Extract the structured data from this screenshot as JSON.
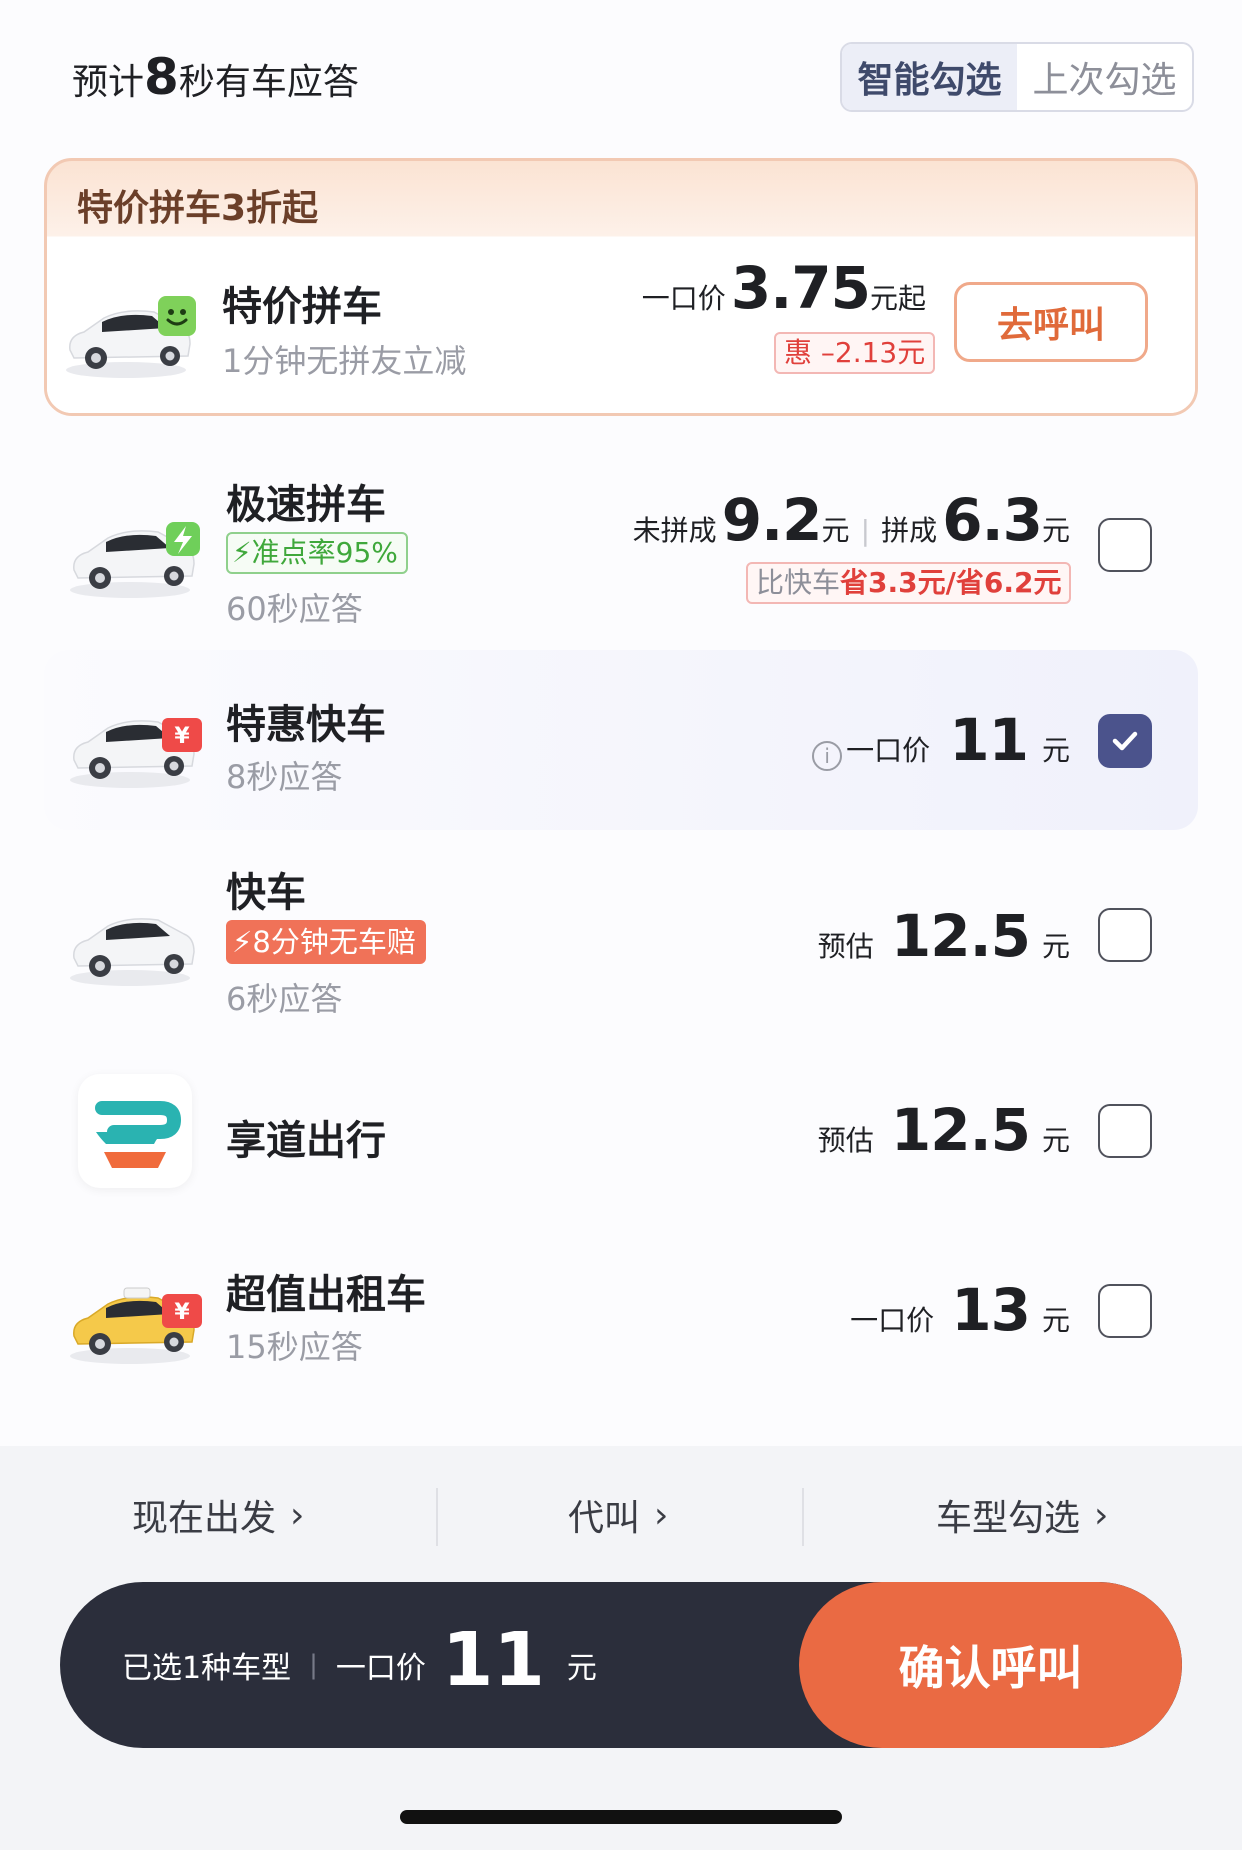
{
  "header": {
    "eta_prefix": "预计",
    "eta_seconds": "8",
    "eta_suffix": "秒有车应答",
    "segment": {
      "options": [
        "智能勾选",
        "上次勾选"
      ],
      "active_index": 0
    }
  },
  "promo": {
    "title": "特价拼车3折起",
    "ride": {
      "name": "特价拼车",
      "subtitle": "1分钟无拼友立减",
      "price_label": "一口价",
      "price": "3.75",
      "price_unit": "元起",
      "discount": "惠 –2.13元",
      "call_label": "去呼叫"
    }
  },
  "rides": [
    {
      "name": "极速拼车",
      "tag": "准点率95%",
      "subtitle": "60秒应答",
      "price_a_label": "未拼成",
      "price_a": "9.2",
      "price_a_unit": "元",
      "price_sep": "|",
      "price_b_label": "拼成",
      "price_b": "6.3",
      "price_b_unit": "元",
      "save_prefix": "比快车",
      "save_highlight": "省3.3元/省6.2元",
      "checked": false
    },
    {
      "name": "特惠快车",
      "subtitle": "8秒应答",
      "price_label": "一口价",
      "price": "11",
      "price_unit": "元",
      "checked": true
    },
    {
      "name": "快车",
      "tag": "8分钟无车赔",
      "subtitle": "6秒应答",
      "price_label": "预估",
      "price": "12.5",
      "price_unit": "元",
      "checked": false
    },
    {
      "name": "享道出行",
      "price_label": "预估",
      "price": "12.5",
      "price_unit": "元",
      "checked": false
    },
    {
      "name": "超值出租车",
      "subtitle": "15秒应答",
      "price_label": "一口价",
      "price": "13",
      "price_unit": "元",
      "checked": false
    }
  ],
  "options_bar": {
    "depart": "现在出发",
    "proxy": "代叫",
    "model_select": "车型勾选"
  },
  "confirm": {
    "selected": "已选1种车型",
    "sep": "|",
    "price_label": "一口价",
    "price": "11",
    "unit": "元",
    "button": "确认呼叫"
  },
  "colors": {
    "accent_orange": "#ea6a43",
    "check_blue": "#4b538c",
    "dark_bar": "#2b2e3b",
    "discount_red": "#e0403b",
    "tag_green": "#3fa83b"
  }
}
